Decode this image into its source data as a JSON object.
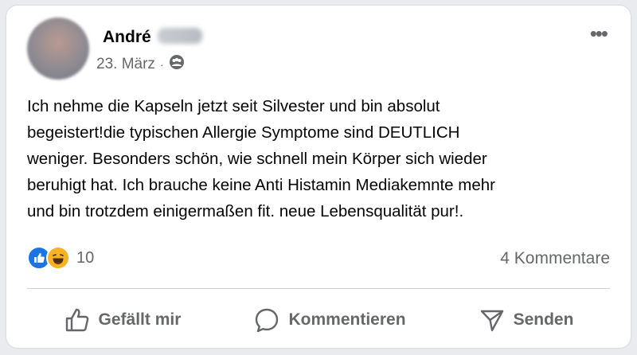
{
  "post": {
    "author_name": "André",
    "date": "23. März",
    "separator": "·",
    "audience_icon": "friends-icon",
    "body": "Ich nehme die Kapseln jetzt seit Silvester und bin absolut\nbegeistert!die typischen Allergie Symptome sind DEUTLICH\nweniger. Besonders schön, wie schnell mein Körper sich wieder\nberuhigt hat. Ich brauche keine Anti Histamin Mediakemnte mehr\nund bin trotzdem einigermaßen fit. neue Lebensqualität pur!.",
    "reaction_count": "10",
    "comment_count": "4 Kommentare"
  },
  "actions": {
    "like_label": "Gefällt mir",
    "comment_label": "Kommentieren",
    "send_label": "Senden"
  },
  "colors": {
    "like_blue": "#1b74e4",
    "haha_yellow": "#f7b125",
    "secondary_text": "#65676b"
  }
}
